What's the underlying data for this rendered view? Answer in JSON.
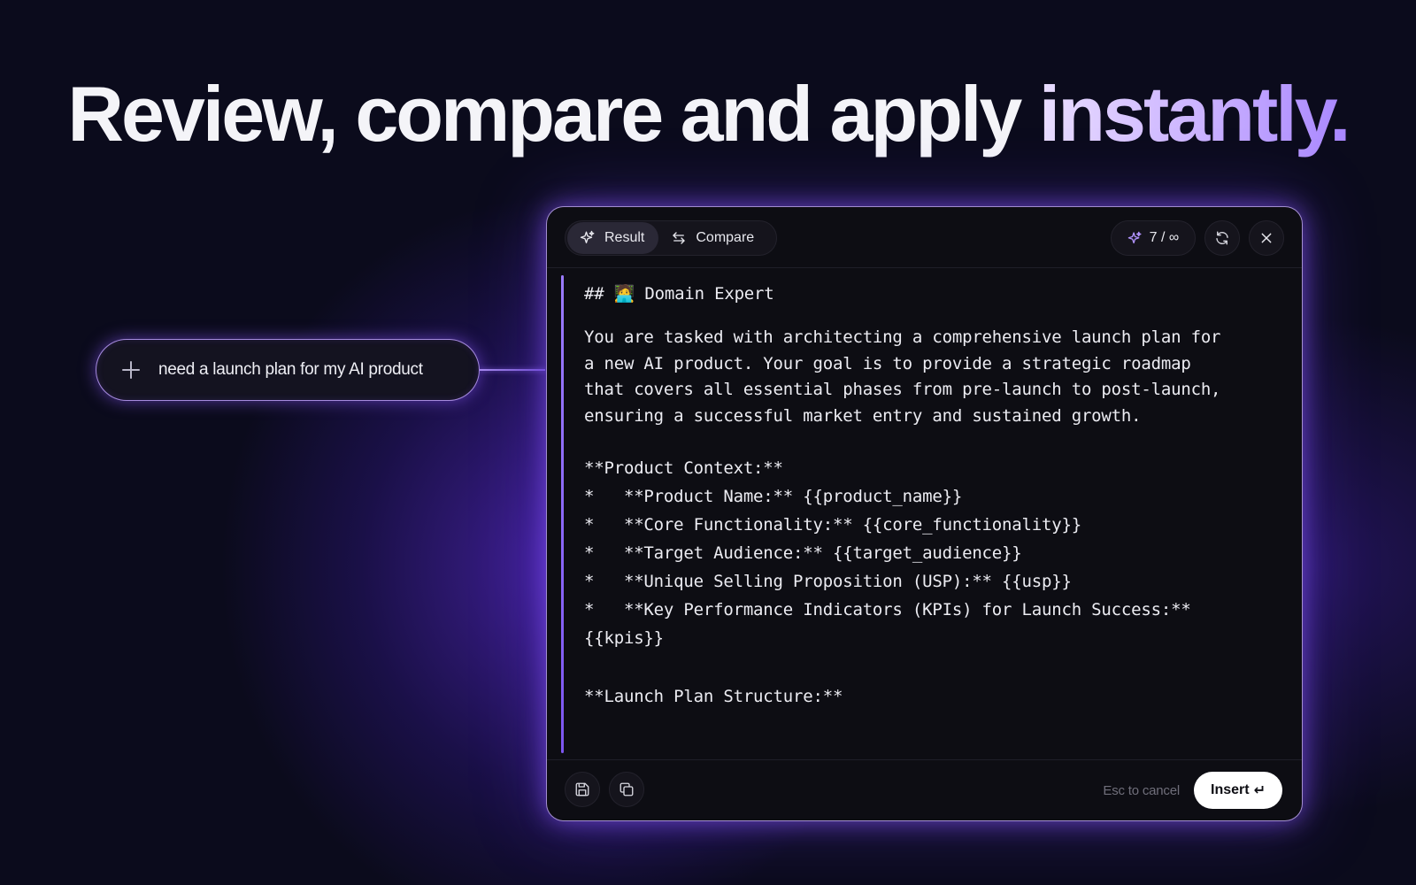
{
  "headline": {
    "main": "Review, compare and apply ",
    "accent": "instantly."
  },
  "prompt": {
    "text": "need a launch plan for my AI product",
    "icon": "plus-icon"
  },
  "panel": {
    "tabs": [
      {
        "label": "Result",
        "icon": "sparkle-icon",
        "active": true
      },
      {
        "label": "Compare",
        "icon": "swap-arrows-icon",
        "active": false
      }
    ],
    "counter": "7 / ∞",
    "counter_icon": "sparkle-icon",
    "refresh_icon": "refresh-icon",
    "close_icon": "close-icon",
    "content": {
      "heading": "## 🧑‍💻 Domain Expert",
      "paragraph": "You are tasked with architecting a comprehensive launch plan for a new AI product. Your goal is to provide a strategic roadmap that covers all essential phases from pre-launch to post-launch, ensuring a successful market entry and sustained growth.",
      "context_title": "**Product Context:**",
      "context_items": [
        "*   **Product Name:** {{product_name}}",
        "*   **Core Functionality:** {{core_functionality}}",
        "*   **Target Audience:** {{target_audience}}",
        "*   **Unique Selling Proposition (USP):** {{usp}}",
        "*   **Key Performance Indicators (KPIs) for Launch Success:**"
      ],
      "context_tail": "{{kpis}}",
      "structure_title": "**Launch Plan Structure:**"
    },
    "footer": {
      "save_icon": "save-icon",
      "copy_icon": "copy-icon",
      "esc_hint": "Esc to cancel",
      "insert_label": "Insert",
      "insert_glyph": "↵"
    }
  },
  "colors": {
    "background": "#0b0b1c",
    "accent_purple": "#9b7bff",
    "panel_bg": "#0d0d13",
    "glow": "#8c5aff"
  }
}
